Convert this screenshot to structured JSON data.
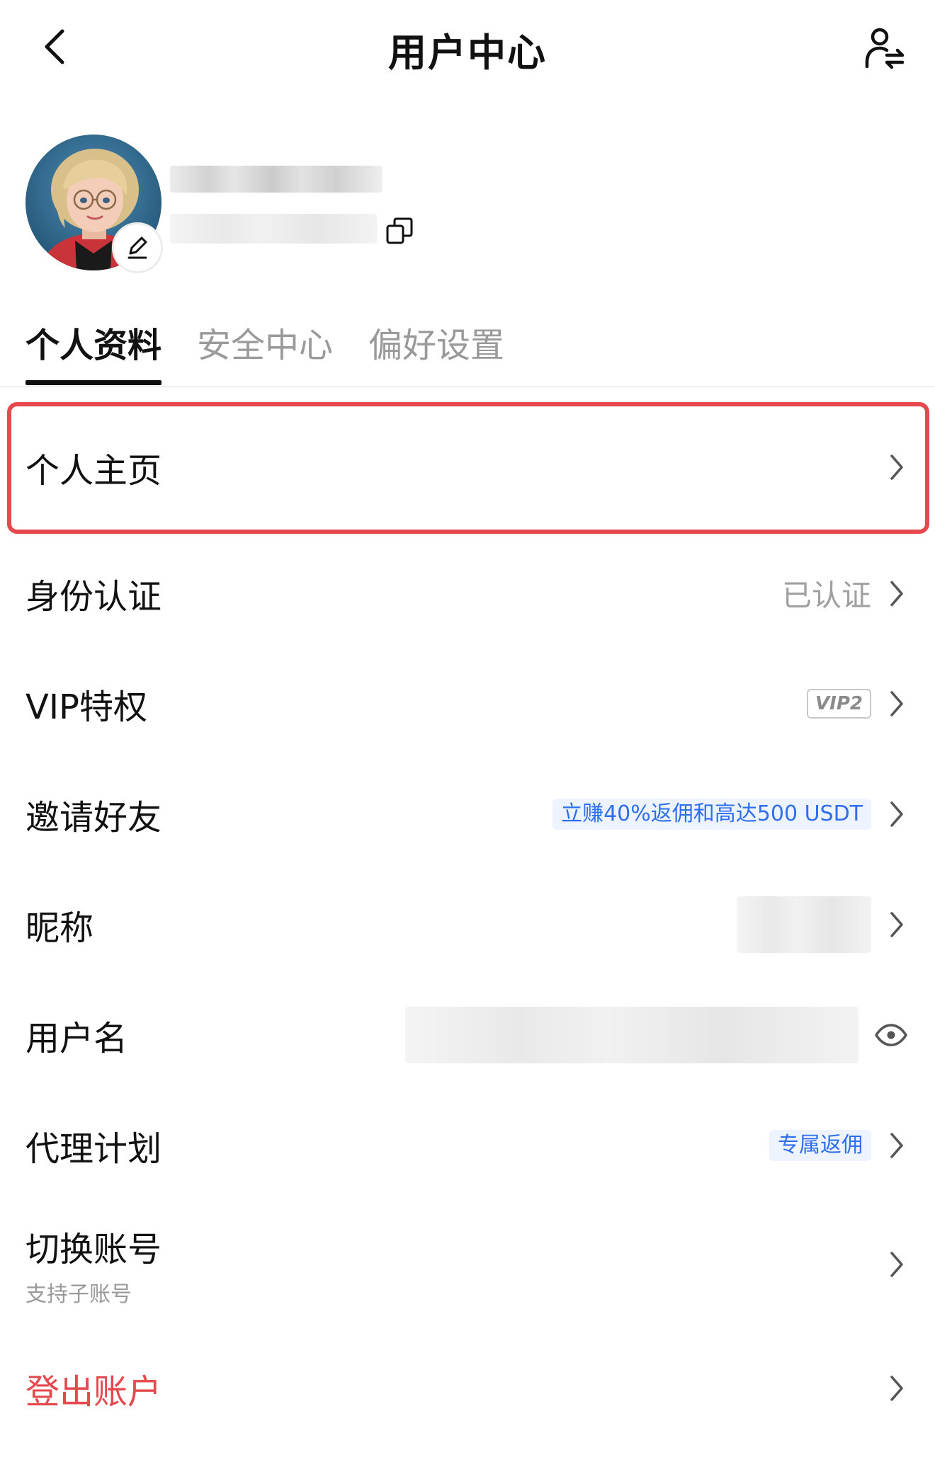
{
  "header": {
    "title": "用户中心",
    "back_icon": "chevron-left-icon",
    "switch_icon": "user-switch-icon"
  },
  "profile": {
    "avatar_icon": "avatar-image",
    "edit_icon": "pencil-icon",
    "copy_icon": "copy-icon"
  },
  "tabs": [
    {
      "label": "个人资料",
      "active": true
    },
    {
      "label": "安全中心",
      "active": false
    },
    {
      "label": "偏好设置",
      "active": false
    }
  ],
  "list": {
    "homepage": {
      "label": "个人主页"
    },
    "identity": {
      "label": "身份认证",
      "value": "已认证"
    },
    "vip": {
      "label": "VIP特权",
      "badge": "VIP2"
    },
    "invite": {
      "label": "邀请好友",
      "promo": "立赚40%返佣和高达500 USDT"
    },
    "nickname": {
      "label": "昵称"
    },
    "username": {
      "label": "用户名",
      "icon": "eye-icon"
    },
    "agent": {
      "label": "代理计划",
      "promo": "专属返佣"
    },
    "switch_account": {
      "label": "切换账号",
      "sub": "支持子账号"
    },
    "logout": {
      "label": "登出账户"
    }
  },
  "colors": {
    "accent": "#2f6fed",
    "danger": "#e5484d",
    "highlight": "#e5484d"
  }
}
